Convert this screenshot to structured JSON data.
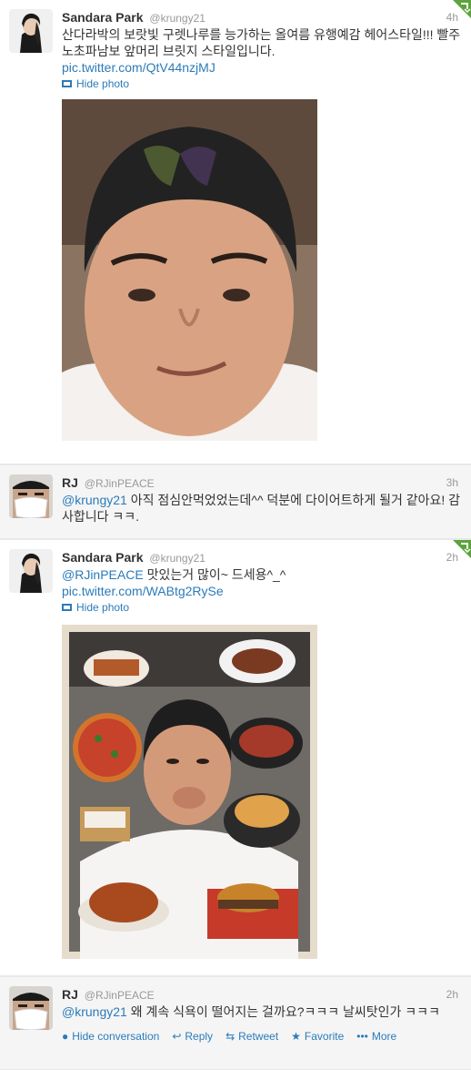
{
  "tweets": [
    {
      "fullname": "Sandara Park",
      "username": "@krungy21",
      "time": "4h",
      "text": "산다라박의 보랏빛 구렛나루를 능가하는 올여름 유행예감 헤어스타일!!! 빨주노초파남보 앞머리 브릿지 스타일입니다.",
      "link": "pic.twitter.com/QtV44nzjMJ",
      "hide_photo": "Hide photo"
    },
    {
      "fullname": "RJ",
      "username": "@RJinPEACE",
      "time": "3h",
      "mention": "@krungy21",
      "text": " 아직 점심안먹었었는데^^ 덕분에 다이어트하게 될거 같아요! 감사합니다 ㅋㅋ."
    },
    {
      "fullname": "Sandara Park",
      "username": "@krungy21",
      "time": "2h",
      "mention": "@RJinPEACE",
      "text": " 맛있는거 많이~ 드세용^_^",
      "link": "pic.twitter.com/WABtg2RySe",
      "hide_photo": "Hide photo"
    },
    {
      "fullname": "RJ",
      "username": "@RJinPEACE",
      "time": "2h",
      "mention": "@krungy21",
      "text": " 왜 계속 식욕이 떨어지는 걸까요?ㅋㅋㅋ 날씨탓인가 ㅋㅋㅋ"
    }
  ],
  "actions": {
    "hide_conversation": "Hide conversation",
    "reply": "Reply",
    "retweet": "Retweet",
    "favorite": "Favorite",
    "more": "More"
  },
  "colors": {
    "link": "#2b7bb9",
    "retweet_corner": "#5ca33d",
    "text": "#333333",
    "muted": "#999999"
  },
  "icons": {
    "corner": "retweet-corner-icon",
    "photo": "photo-icon",
    "conversation": "conversation-icon",
    "reply": "reply-icon",
    "retweet": "retweet-icon",
    "favorite": "star-icon",
    "more": "ellipsis-icon"
  }
}
